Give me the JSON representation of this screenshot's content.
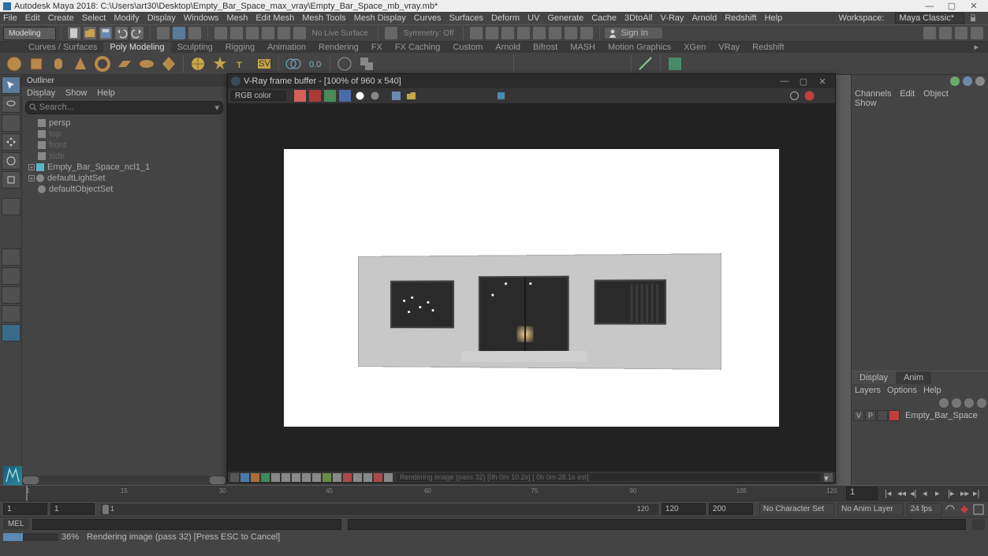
{
  "title": "Autodesk Maya 2018: C:\\Users\\art30\\Desktop\\Empty_Bar_Space_max_vray\\Empty_Bar_Space_mb_vray.mb*",
  "menu": [
    "File",
    "Edit",
    "Create",
    "Select",
    "Modify",
    "Display",
    "Windows",
    "Mesh",
    "Edit Mesh",
    "Mesh Tools",
    "Mesh Display",
    "Curves",
    "Surfaces",
    "Deform",
    "UV",
    "Generate",
    "Cache",
    "3DtoAll",
    "V-Ray",
    "Arnold",
    "Redshift",
    "Help"
  ],
  "workspace_label": "Workspace:",
  "workspace_value": "Maya Classic*",
  "mode_dropdown": "Modeling",
  "surface_text": "No Live Surface",
  "symmetry_text": "Symmetry: Off",
  "signin": "Sign In",
  "shelf_tabs": [
    "Curves / Surfaces",
    "Poly Modeling",
    "Sculpting",
    "Rigging",
    "Animation",
    "Rendering",
    "FX",
    "FX Caching",
    "Custom",
    "Arnold",
    "Bifrost",
    "MASH",
    "Motion Graphics",
    "XGen",
    "VRay",
    "Redshift"
  ],
  "shelf_tabs_active": "Poly Modeling",
  "outliner": {
    "title": "Outliner",
    "menu": [
      "Display",
      "Show",
      "Help"
    ],
    "search_ph": "Search...",
    "items": [
      {
        "label": "persp",
        "t": "cam"
      },
      {
        "label": "top",
        "t": "cam",
        "dim": true
      },
      {
        "label": "front",
        "t": "cam",
        "dim": true
      },
      {
        "label": "side",
        "t": "cam",
        "dim": true
      },
      {
        "label": "Empty_Bar_Space_ncl1_1",
        "t": "grp",
        "exp": true
      },
      {
        "label": "defaultLightSet",
        "t": "set",
        "exp": true
      },
      {
        "label": "defaultObjectSet",
        "t": "set"
      }
    ]
  },
  "vfb": {
    "title": "V-Ray frame buffer - [100% of 960 x 540]",
    "channel": "RGB color",
    "status": "Rendering image (pass 32) [0h  0m 10.2s] [ 0h  0m 28.1s est]"
  },
  "channel_box": {
    "menu": [
      "Channels",
      "Edit",
      "Object",
      "Show"
    ]
  },
  "layers": {
    "tabs": [
      "Display",
      "Anim"
    ],
    "tabs_active": "Display",
    "menu": [
      "Layers",
      "Options",
      "Help"
    ],
    "row": {
      "v": "V",
      "p": "P",
      "name": "Empty_Bar_Space"
    }
  },
  "time": {
    "ticks": [
      "1",
      "15",
      "30",
      "45",
      "60",
      "75",
      "90",
      "105",
      "120"
    ],
    "start": "1",
    "start2": "1",
    "range_start": "1",
    "end": "120",
    "end2": "120",
    "end3": "200",
    "char_set": "No Character Set",
    "anim_layer": "No Anim Layer",
    "fps": "24 fps",
    "curframe": "1"
  },
  "cmd": {
    "lang": "MEL"
  },
  "help": {
    "pct": "36%",
    "text": "Rendering image (pass 32) [Press ESC to Cancel]"
  }
}
